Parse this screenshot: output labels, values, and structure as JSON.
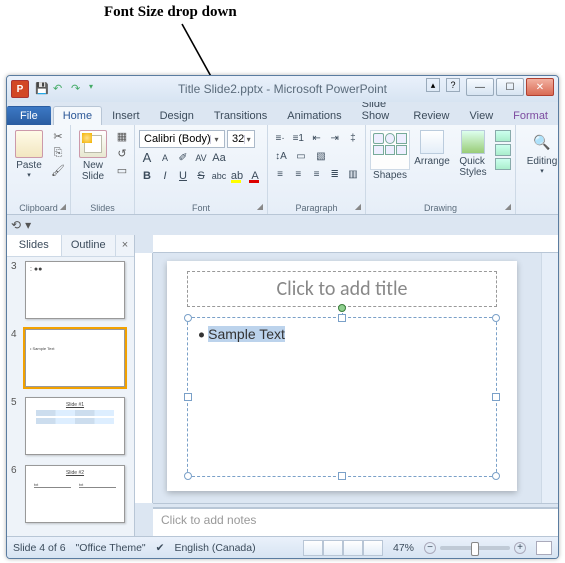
{
  "callout": "Font Size drop down",
  "title": "Title Slide2.pptx - Microsoft PowerPoint",
  "app_icon_letter": "P",
  "tabs": {
    "file": "File",
    "home": "Home",
    "insert": "Insert",
    "design": "Design",
    "transitions": "Transitions",
    "animations": "Animations",
    "slideshow": "Slide Show",
    "review": "Review",
    "view": "View",
    "format": "Format"
  },
  "groups": {
    "clipboard": "Clipboard",
    "slides": "Slides",
    "font": "Font",
    "paragraph": "Paragraph",
    "drawing": "Drawing",
    "editing": "Editing"
  },
  "buttons": {
    "paste": "Paste",
    "new_slide": "New\nSlide",
    "shapes": "Shapes",
    "arrange": "Arrange",
    "quick_styles": "Quick\nStyles",
    "editing": "Editing",
    "bold": "B",
    "italic": "I",
    "underline": "U",
    "strike": "S",
    "shadow": "abc",
    "spacing": "AV",
    "clear": "Aa",
    "grow": "A",
    "shrink": "A",
    "fontcolor": "A",
    "highlight": "ab"
  },
  "font": {
    "name": "Calibri (Body)",
    "size": "32"
  },
  "thumb_tabs": {
    "slides": "Slides",
    "outline": "Outline"
  },
  "thumbs": [
    {
      "n": "3"
    },
    {
      "n": "4",
      "selected": true
    },
    {
      "n": "5",
      "title": "Slide #1"
    },
    {
      "n": "6",
      "title": "Slide #2"
    }
  ],
  "slide": {
    "title_placeholder": "Click to add title",
    "bullet_text": "Sample Text",
    "notes_placeholder": "Click to add notes"
  },
  "status": {
    "slide": "Slide 4 of 6",
    "theme": "\"Office Theme\"",
    "lang": "English (Canada)",
    "zoom": "47%"
  }
}
